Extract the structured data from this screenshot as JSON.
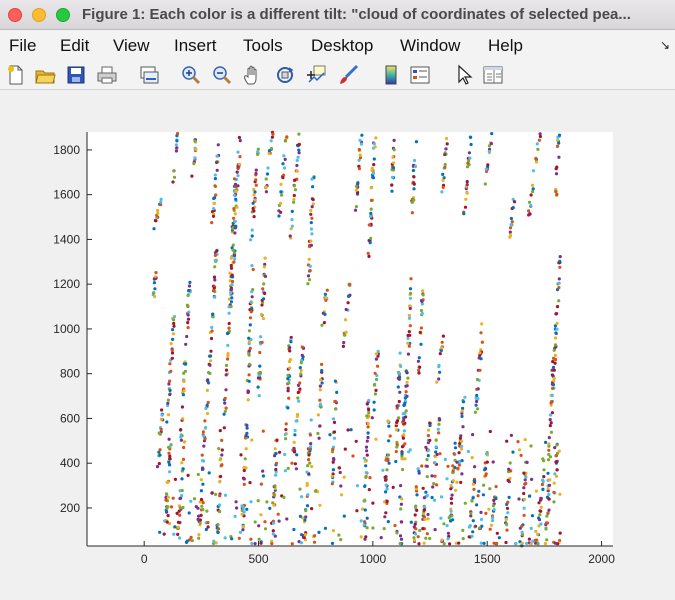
{
  "window": {
    "title": "Figure 1: Each color is a different tilt: \"cloud of coordinates of selected pea..."
  },
  "menu": {
    "items": [
      "File",
      "Edit",
      "View",
      "Insert",
      "Tools",
      "Desktop",
      "Window",
      "Help"
    ]
  },
  "toolbar": {
    "icons": [
      "new-figure-icon",
      "open-file-icon",
      "save-icon",
      "print-icon",
      "link-plot-icon",
      "zoom-in-icon",
      "zoom-out-icon",
      "pan-hand-icon",
      "rotate-3d-icon",
      "data-cursor-icon",
      "brush-icon",
      "colorbar-icon",
      "legend-icon",
      "pointer-icon",
      "property-editor-icon"
    ]
  },
  "colors": {
    "series": [
      "#0072bd",
      "#d95319",
      "#edb120",
      "#7e2f8e",
      "#77ac30",
      "#4dbeee",
      "#a2142f"
    ]
  },
  "chart_data": {
    "type": "scatter",
    "title": "",
    "xlabel": "",
    "ylabel": "",
    "xlim": [
      -250,
      2050
    ],
    "ylim": [
      30,
      1880
    ],
    "xticks": [
      0,
      500,
      1000,
      1500,
      2000
    ],
    "yticks": [
      200,
      400,
      600,
      800,
      1000,
      1200,
      1400,
      1600,
      1800
    ],
    "grid": false,
    "legend": false,
    "note_series": "Each color is a different tilt",
    "segments": [
      [
        40,
        1120,
        50,
        1250
      ],
      [
        45,
        1450,
        75,
        1580
      ],
      [
        60,
        380,
        80,
        650
      ],
      [
        90,
        80,
        120,
        560
      ],
      [
        100,
        560,
        130,
        1060
      ],
      [
        130,
        1650,
        145,
        1880
      ],
      [
        150,
        80,
        175,
        500
      ],
      [
        160,
        500,
        200,
        1220
      ],
      [
        210,
        1680,
        230,
        1880
      ],
      [
        240,
        60,
        265,
        560
      ],
      [
        270,
        580,
        320,
        1400
      ],
      [
        300,
        1480,
        330,
        1880
      ],
      [
        320,
        80,
        340,
        480
      ],
      [
        350,
        560,
        400,
        1700
      ],
      [
        380,
        1100,
        420,
        1880
      ],
      [
        430,
        100,
        450,
        600
      ],
      [
        450,
        650,
        475,
        1280
      ],
      [
        470,
        1400,
        500,
        1880
      ],
      [
        500,
        700,
        530,
        1320
      ],
      [
        530,
        1600,
        560,
        1880
      ],
      [
        560,
        80,
        580,
        520
      ],
      [
        590,
        1500,
        625,
        1880
      ],
      [
        620,
        500,
        640,
        1000
      ],
      [
        640,
        1400,
        680,
        1880
      ],
      [
        650,
        400,
        700,
        980
      ],
      [
        700,
        40,
        730,
        600
      ],
      [
        720,
        1200,
        740,
        1700
      ],
      [
        760,
        500,
        780,
        850
      ],
      [
        780,
        1000,
        800,
        1180
      ],
      [
        820,
        300,
        840,
        780
      ],
      [
        870,
        900,
        900,
        1200
      ],
      [
        920,
        1500,
        950,
        1880
      ],
      [
        960,
        60,
        980,
        700
      ],
      [
        980,
        1300,
        1010,
        1880
      ],
      [
        1000,
        600,
        1020,
        900
      ],
      [
        1050,
        100,
        1070,
        600
      ],
      [
        1080,
        1600,
        1100,
        1880
      ],
      [
        1100,
        400,
        1120,
        900
      ],
      [
        1120,
        200,
        1140,
        700
      ],
      [
        1140,
        600,
        1170,
        1230
      ],
      [
        1170,
        1500,
        1190,
        1880
      ],
      [
        1180,
        40,
        1200,
        400
      ],
      [
        1200,
        800,
        1220,
        1180
      ],
      [
        1220,
        100,
        1250,
        600
      ],
      [
        1260,
        250,
        1290,
        600
      ],
      [
        1280,
        750,
        1310,
        980
      ],
      [
        1300,
        1600,
        1330,
        1880
      ],
      [
        1330,
        50,
        1360,
        500
      ],
      [
        1370,
        300,
        1400,
        700
      ],
      [
        1400,
        1500,
        1430,
        1880
      ],
      [
        1420,
        50,
        1450,
        400
      ],
      [
        1450,
        600,
        1480,
        1030
      ],
      [
        1470,
        100,
        1500,
        450
      ],
      [
        1490,
        1650,
        1520,
        1880
      ],
      [
        1520,
        100,
        1540,
        300
      ],
      [
        1580,
        40,
        1600,
        400
      ],
      [
        1600,
        1400,
        1620,
        1600
      ],
      [
        1650,
        30,
        1670,
        400
      ],
      [
        1680,
        1500,
        1730,
        1880
      ],
      [
        1720,
        40,
        1750,
        420
      ],
      [
        1760,
        100,
        1790,
        900
      ],
      [
        1780,
        600,
        1820,
        1330
      ],
      [
        1790,
        200,
        1810,
        500
      ],
      [
        1800,
        1600,
        1815,
        1880
      ]
    ]
  }
}
